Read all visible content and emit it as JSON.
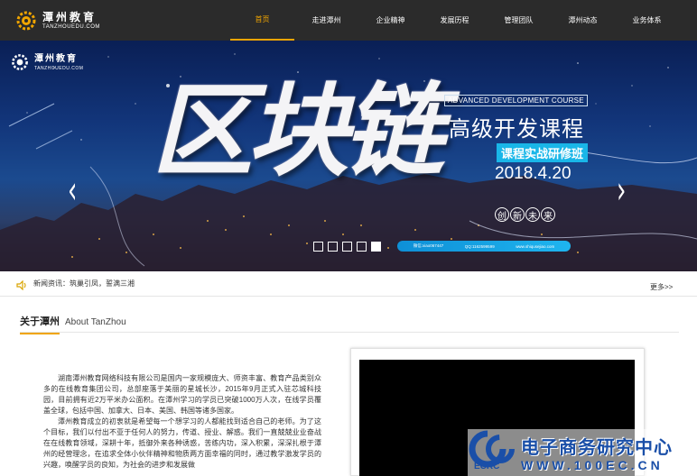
{
  "nav": {
    "logo_cn": "潭州教育",
    "logo_en": "TANZHOUEDU.COM",
    "items": [
      {
        "label": "首页"
      },
      {
        "label": "走进潭州"
      },
      {
        "label": "企业精神"
      },
      {
        "label": "发展历程"
      },
      {
        "label": "管理团队"
      },
      {
        "label": "潭州动态"
      },
      {
        "label": "业务体系"
      }
    ],
    "active_index": 0,
    "accent_color": "#f0a500"
  },
  "banner": {
    "logo_cn": "潭州教育",
    "logo_en": "TANZHOUEDU.COM",
    "big_title": "区块链",
    "adv_label": "ADVANCED DEVELOPMENT COURSE",
    "course_title": "高级开发课程",
    "class_badge": "课程实战研修班",
    "date": "2018.4.20",
    "innovation": [
      "创",
      "新",
      "未",
      "来"
    ],
    "contact": {
      "wechat": "微信:xiao067447",
      "qq": "QQ:1162599599",
      "site": "www.shiqusejiao.com"
    },
    "prev_icon": "chevron-left-icon",
    "next_icon": "chevron-right-icon",
    "slide_count": 5,
    "active_slide": 4
  },
  "news": {
    "text": "新闻资讯：筑巢引凤，誓满三湘",
    "more": "更多>>"
  },
  "about": {
    "title_cn": "关于潭州",
    "title_en": "About TanZhou",
    "paragraphs": [
      "湖南潭州教育网络科技有限公司是国内一家规模庞大、师资丰富、教育产品类别众多的在线教育集团公司，总部座落于美丽的星城长沙，2015年9月正式入驻芯城科技园，目前拥有近2万平米办公面积。在潭州学习的学员已突破1000万人次，在线学员覆盖全球，包括中国、加拿大、日本、美国、韩国等诸多国家。",
      "潭州教育成立的初衷就是希望每一个想学习的人都能找到适合自己的老师。为了这个目标，我们以付出不亚于任何人的努力，传道、授业、解惑。我们一直兢兢业业奋战在在线教育领域，深耕十年，抵御外来各种诱惑，苦练内功，深入积累，深深扎根于潭州的经营理念，在追求全体小伙伴精神和物质两方面幸福的同时，通过教学激发学员的兴趣，唤醒学员的良知，为社会的进步和发展做"
    ]
  },
  "watermark": {
    "title": "电子商务研究中心",
    "url": "WWW.100EC.CN",
    "ecrc": "ECRC",
    "color": "#1a4fa8"
  }
}
